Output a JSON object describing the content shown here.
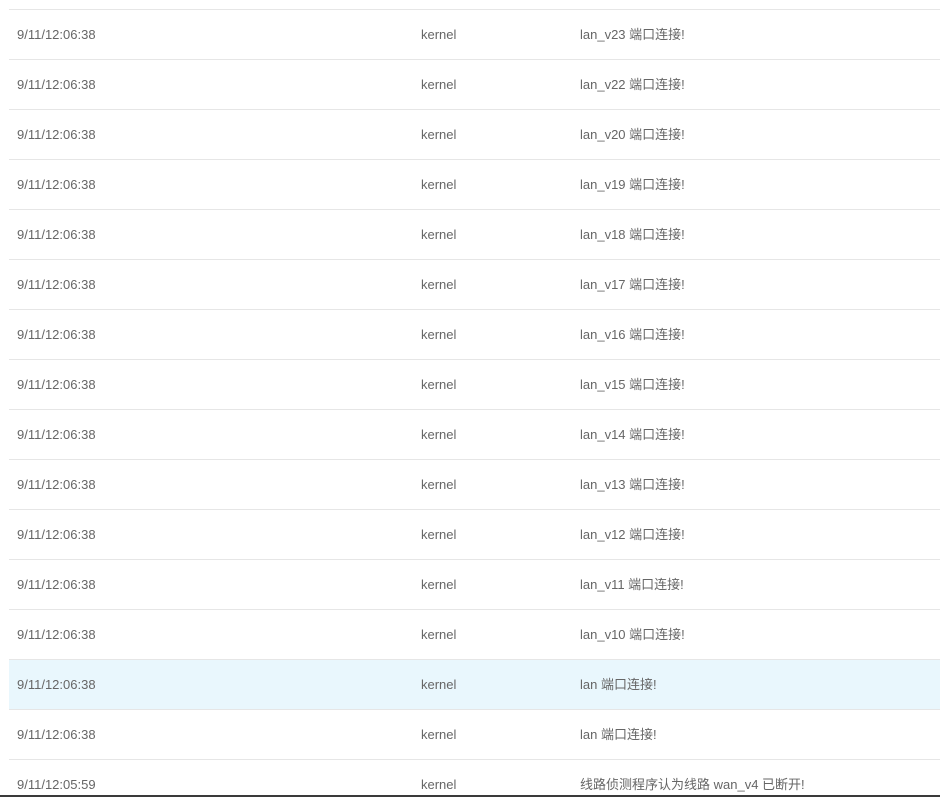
{
  "log": {
    "rows": [
      {
        "time": "9/11/12:06:38",
        "source": "kernel",
        "message": "lan_v23 端口连接!"
      },
      {
        "time": "9/11/12:06:38",
        "source": "kernel",
        "message": "lan_v22 端口连接!"
      },
      {
        "time": "9/11/12:06:38",
        "source": "kernel",
        "message": "lan_v20 端口连接!"
      },
      {
        "time": "9/11/12:06:38",
        "source": "kernel",
        "message": "lan_v19 端口连接!"
      },
      {
        "time": "9/11/12:06:38",
        "source": "kernel",
        "message": "lan_v18 端口连接!"
      },
      {
        "time": "9/11/12:06:38",
        "source": "kernel",
        "message": "lan_v17 端口连接!"
      },
      {
        "time": "9/11/12:06:38",
        "source": "kernel",
        "message": "lan_v16 端口连接!"
      },
      {
        "time": "9/11/12:06:38",
        "source": "kernel",
        "message": "lan_v15 端口连接!"
      },
      {
        "time": "9/11/12:06:38",
        "source": "kernel",
        "message": "lan_v14 端口连接!"
      },
      {
        "time": "9/11/12:06:38",
        "source": "kernel",
        "message": "lan_v13 端口连接!"
      },
      {
        "time": "9/11/12:06:38",
        "source": "kernel",
        "message": "lan_v12 端口连接!"
      },
      {
        "time": "9/11/12:06:38",
        "source": "kernel",
        "message": "lan_v11 端口连接!"
      },
      {
        "time": "9/11/12:06:38",
        "source": "kernel",
        "message": "lan_v10 端口连接!"
      },
      {
        "time": "9/11/12:06:38",
        "source": "kernel",
        "message": "lan 端口连接!"
      },
      {
        "time": "9/11/12:06:38",
        "source": "kernel",
        "message": "lan 端口连接!"
      },
      {
        "time": "9/11/12:05:59",
        "source": "kernel",
        "message": "线路侦测程序认为线路 wan_v4 已断开!"
      }
    ],
    "highlighted_row_index": 13
  },
  "colors": {
    "text": "#666666",
    "row_divider": "#e6e6e6",
    "highlight_background": "#e9f7fd"
  }
}
